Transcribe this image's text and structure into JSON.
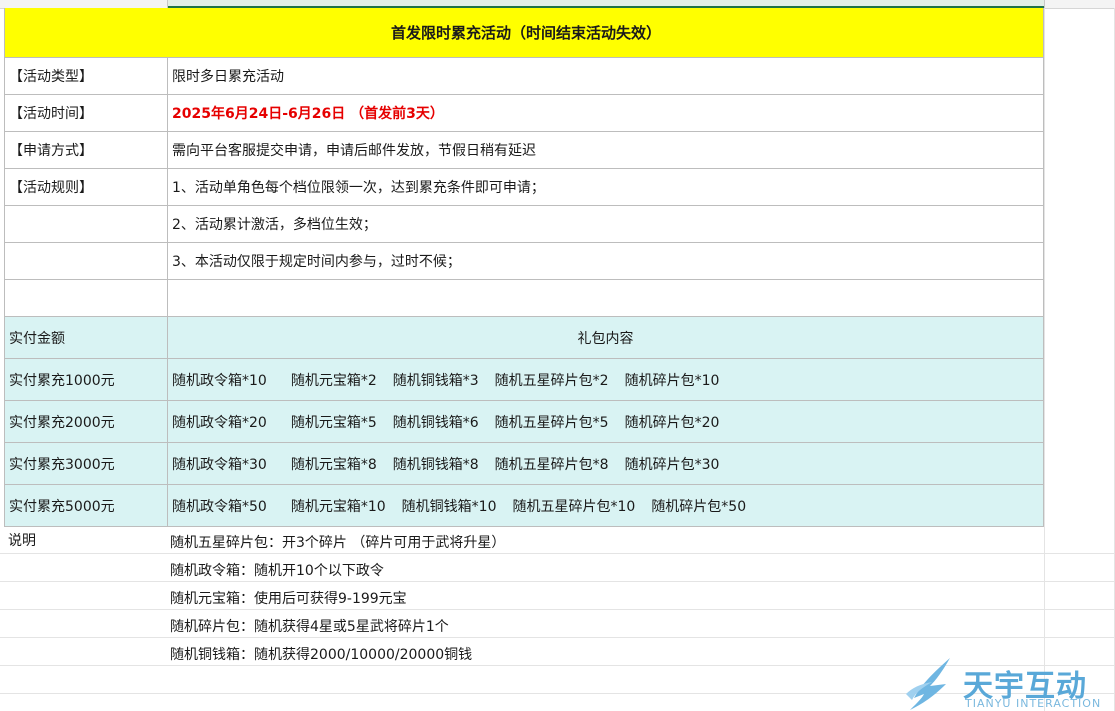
{
  "title": "首发限时累充活动（时间结束活动失效）",
  "info_rows": [
    {
      "label": "【活动类型】",
      "value": "限时多日累充活动",
      "highlight": false
    },
    {
      "label": "【活动时间】",
      "value": "2025年6月24日-6月26日 （首发前3天）",
      "highlight": true
    },
    {
      "label": "【申请方式】",
      "value": "需向平台客服提交申请，申请后邮件发放，节假日稍有延迟",
      "highlight": false
    },
    {
      "label": "【活动规则】",
      "value": "1、活动单角色每个档位限领一次，达到累充条件即可申请；",
      "highlight": false
    },
    {
      "label": "",
      "value": "2、活动累计激活，多档位生效；",
      "highlight": false
    },
    {
      "label": "",
      "value": "3、本活动仅限于规定时间内参与，过时不候；",
      "highlight": false
    },
    {
      "label": "",
      "value": "",
      "highlight": false
    }
  ],
  "table": {
    "header": {
      "amount": "实付金额",
      "content": "礼包内容"
    },
    "rows": [
      {
        "amount": "实付累充1000元",
        "gifts": [
          "随机政令箱*10",
          "随机元宝箱*2",
          "随机铜钱箱*3",
          "随机五星碎片包*2",
          "随机碎片包*10"
        ]
      },
      {
        "amount": "实付累充2000元",
        "gifts": [
          "随机政令箱*20",
          "随机元宝箱*5",
          "随机铜钱箱*6",
          "随机五星碎片包*5",
          "随机碎片包*20"
        ]
      },
      {
        "amount": "实付累充3000元",
        "gifts": [
          "随机政令箱*30",
          "随机元宝箱*8",
          "随机铜钱箱*8",
          "随机五星碎片包*8",
          "随机碎片包*30"
        ]
      },
      {
        "amount": "实付累充5000元",
        "gifts": [
          "随机政令箱*50",
          "随机元宝箱*10",
          "随机铜钱箱*10",
          "随机五星碎片包*10",
          "随机碎片包*50"
        ]
      }
    ]
  },
  "notes": {
    "label": "说明",
    "lines": [
      "随机五星碎片包：开3个碎片 （碎片可用于武将升星）",
      "随机政令箱：随机开10个以下政令",
      "随机元宝箱：使用后可获得9-199元宝",
      "随机碎片包：随机获得4星或5星武将碎片1个",
      "随机铜钱箱：随机获得2000/10000/20000铜钱"
    ]
  },
  "watermark": {
    "main": "天宇互动",
    "sub": "TIANYU INTERACTION"
  },
  "colors": {
    "title_bg": "#ffff00",
    "table_bg": "#d9f3f3",
    "highlight": "#e60000",
    "logo": "#59a8d8"
  }
}
